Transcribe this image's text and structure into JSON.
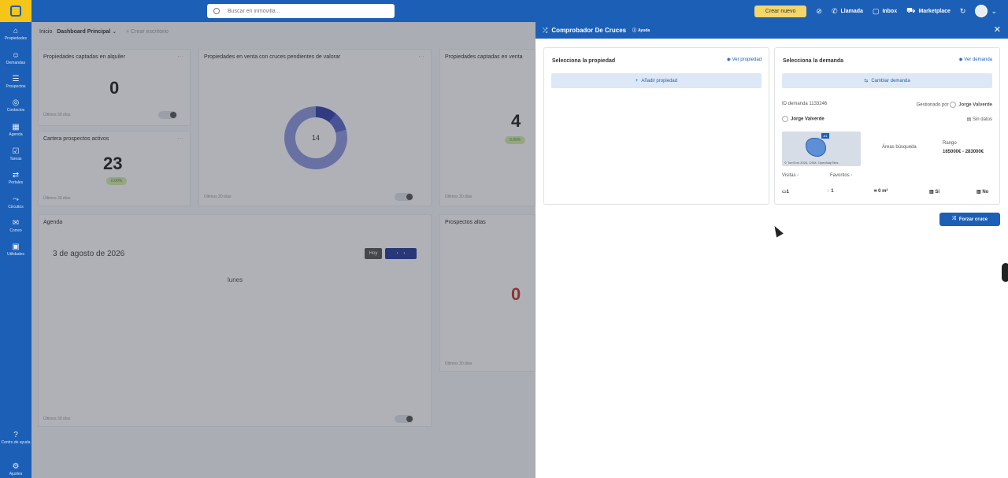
{
  "topbar": {
    "search_placeholder": "Buscar en inmovilla...",
    "create_label": "Crear nuevo",
    "call_label": "Llamada",
    "inbox_label": "Inbox",
    "marketplace_label": "Marketplace"
  },
  "sidebar": {
    "items": [
      {
        "label": "Propiedades",
        "icon": "home-icon"
      },
      {
        "label": "Demandas",
        "icon": "users-icon"
      },
      {
        "label": "Prospectos",
        "icon": "list-icon"
      },
      {
        "label": "Contactos",
        "icon": "contact-icon"
      },
      {
        "label": "Agenda",
        "icon": "calendar-icon"
      },
      {
        "label": "Tareas",
        "icon": "tasks-icon"
      },
      {
        "label": "Portales",
        "icon": "portals-icon"
      },
      {
        "label": "Circuitos",
        "icon": "circuits-icon"
      },
      {
        "label": "Correo",
        "icon": "mail-icon"
      },
      {
        "label": "Utilidades",
        "icon": "tools-icon"
      },
      {
        "label": "Centro de ayuda",
        "icon": "help-icon"
      },
      {
        "label": "Ajustes",
        "icon": "gear-icon"
      }
    ]
  },
  "dashboard": {
    "breadcrumb": {
      "home": "Inicio",
      "current": "Dashboard Principal",
      "extra": "+ Crear escritorio"
    },
    "cards": {
      "rent": {
        "title": "Propiedades captadas en alquiler",
        "value": "0",
        "footer": "Últimos 30 días"
      },
      "pending": {
        "title": "Propiedades en venta con cruces pendientes de valorar",
        "value": "14",
        "footer": "Últimos 30 días"
      },
      "sale": {
        "title": "Propiedades captadas en venta",
        "value": "4",
        "badge": "0.00%",
        "footer": "Últimos 30 días"
      },
      "portfolio": {
        "title": "Cartera prospectos activos",
        "value": "23",
        "badge": "0.00%",
        "footer": "Últimos 30 días"
      },
      "agenda": {
        "title": "Agenda",
        "date": "3 de agosto de 2026",
        "today": "Hoy",
        "weekday": "lunes",
        "footer": "Últimos 30 días"
      },
      "prospects": {
        "title": "Prospectos altas",
        "value": "0",
        "footer": "Últimos 30 días"
      }
    }
  },
  "drawer": {
    "title": "Comprobador De Cruces",
    "help": "Ayuda",
    "property_panel": {
      "title": "Selecciona la propiedad",
      "link": "Ver propiedad",
      "button": "Añadir propiedad"
    },
    "demand_panel": {
      "title": "Selecciona la demanda",
      "link": "Ver demanda",
      "button": "Cambiar demanda",
      "id_label": "ID demanda",
      "id_value": "1133246",
      "managed_label": "Gestionado por",
      "managed_value": "Jorge Valverde",
      "client": "Jorge Valverde",
      "no_data": "Sin datos",
      "map_copy": "© TomTom 2026, OSM, OpenMapTiles",
      "areas_label": "Áreas búsqueda",
      "range_label": "Rango",
      "range_value": "165000€ - 283000€",
      "visits_label": "Visitas",
      "favorites_label": "Favoritos",
      "rooms": "1",
      "baths": "1",
      "area": "0 m²",
      "feature1": "Sí",
      "feature2": "No"
    },
    "force_button": "Forzar cruce"
  }
}
